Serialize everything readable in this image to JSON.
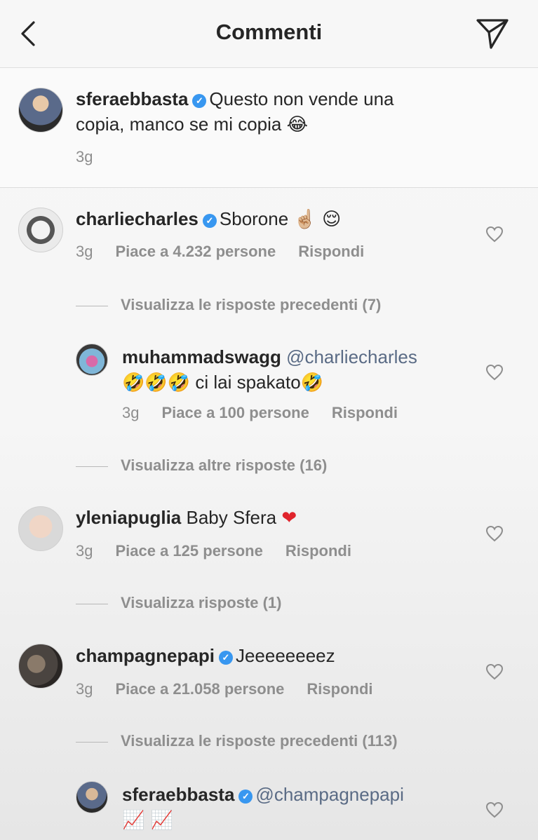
{
  "header": {
    "title": "Commenti",
    "back_icon": "chevron-left-icon",
    "send_icon": "paper-plane-icon"
  },
  "caption": {
    "username": "sferaebbasta",
    "text_line1": "Questo non vende una",
    "text_line2": "copia, manco se mi copia",
    "emoji": "😂",
    "time": "3g"
  },
  "comments": [
    {
      "username": "charliecharles",
      "text": "Sborone",
      "emoji": "☝🏼 😌",
      "time": "3g",
      "likes": "Piace a 4.232 persone",
      "reply": "Rispondi",
      "view_replies": "Visualizza le risposte precedenti (7)",
      "sub_reply": {
        "username": "muhammadswagg",
        "mention": "@charliecharles",
        "text_line2": "ci lai spakato",
        "emoji_prefix": "🤣🤣🤣",
        "emoji_suffix": "🤣",
        "time": "3g",
        "likes": "Piace a 100 persone",
        "reply": "Rispondi"
      },
      "more_replies": "Visualizza altre risposte (16)"
    },
    {
      "username": "yleniapuglia",
      "text": "Baby Sfera",
      "emoji": "❤",
      "time": "3g",
      "likes": "Piace a 125 persone",
      "reply": "Rispondi",
      "view_replies": "Visualizza risposte (1)"
    },
    {
      "username": "champagnepapi",
      "text": "Jeeeeeeeez",
      "time": "3g",
      "likes": "Piace a 21.058 persone",
      "reply": "Rispondi",
      "view_replies": "Visualizza le risposte precedenti (113)",
      "sub_reply": {
        "username": "sferaebbasta",
        "mention": "@champagnepapi",
        "emoji": "📈 📈"
      }
    }
  ],
  "colors": {
    "verified": "#3897f0",
    "meta_gray": "#8e8e8e",
    "heart_red": "#e0242c"
  }
}
